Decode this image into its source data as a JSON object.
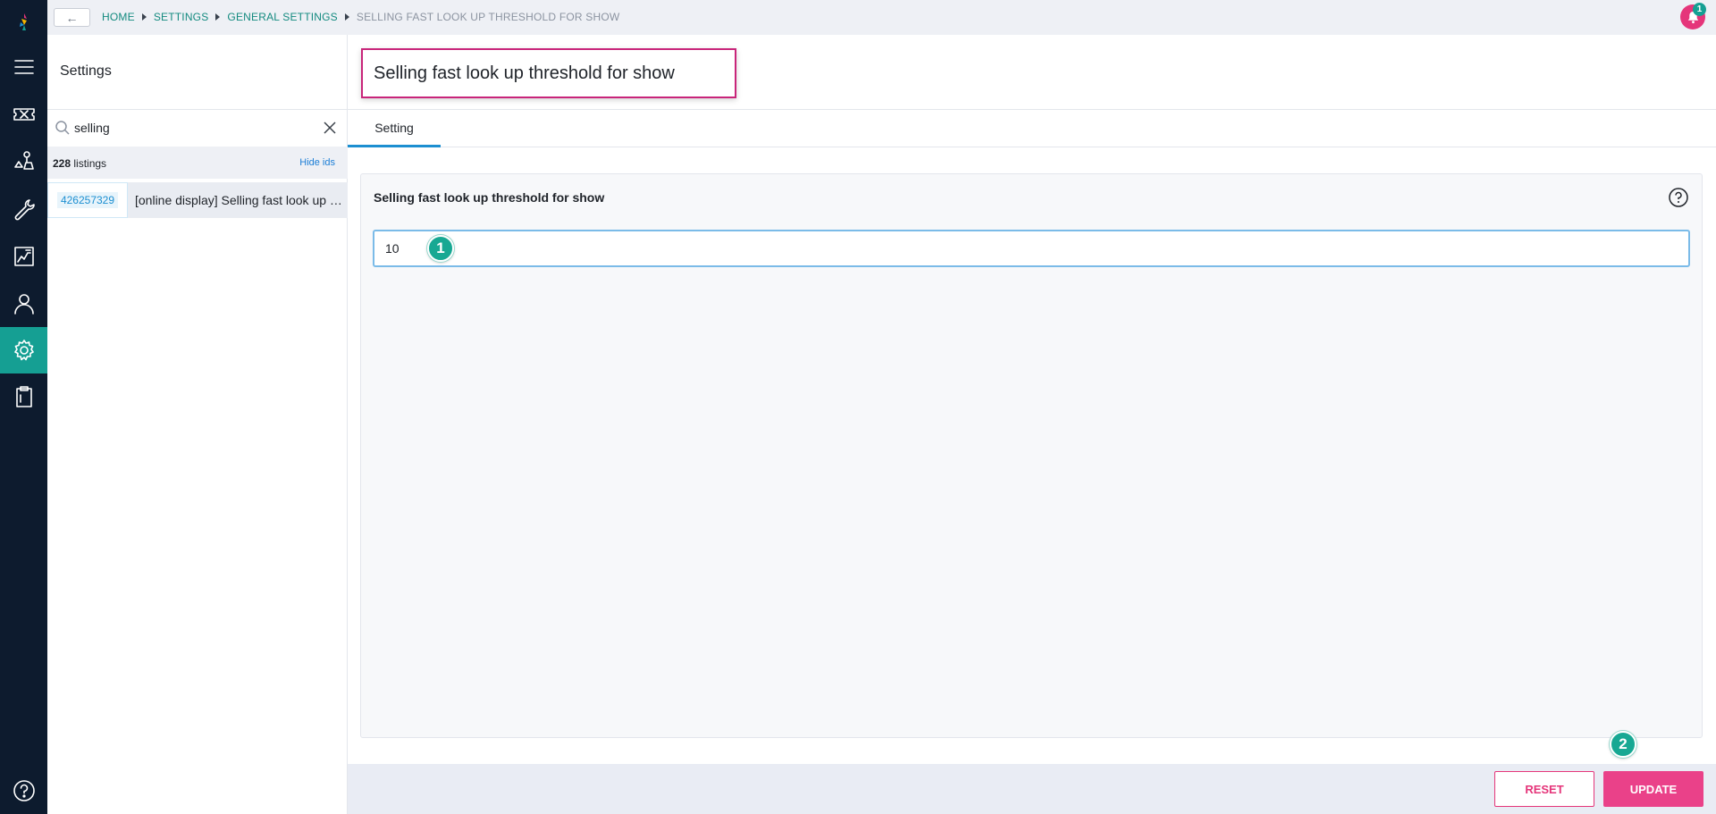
{
  "breadcrumb": {
    "items": [
      "HOME",
      "SETTINGS",
      "GENERAL SETTINGS"
    ],
    "current": "SELLING FAST LOOK UP THRESHOLD FOR SHOW"
  },
  "notifications": {
    "count": "1"
  },
  "settings_panel": {
    "title": "Settings",
    "search_value": "selling",
    "listings_count": "228",
    "listings_label": " listings",
    "hide_ids_label": "Hide ids",
    "results": [
      {
        "id": "426257329",
        "text": "[online display] Selling fast look up threshold for show"
      }
    ]
  },
  "page": {
    "title": "Selling fast look up threshold for show",
    "tabs": [
      {
        "label": "Setting"
      }
    ],
    "setting": {
      "label": "Selling fast look up threshold for show",
      "value": "10"
    },
    "steps": [
      "1",
      "2"
    ],
    "buttons": {
      "reset": "RESET",
      "update": "UPDATE"
    }
  },
  "icons": {
    "rail": [
      "brand-logo-icon",
      "menu-icon",
      "ticket-icon",
      "scale-icon",
      "wrench-icon",
      "report-icon",
      "user-icon",
      "gear-icon",
      "clipboard-icon",
      "help-icon"
    ]
  },
  "colors": {
    "rail_bg": "#0d1b2e",
    "active_teal": "#159f93",
    "accent_pink": "#e5357a",
    "link_teal": "#138a7f",
    "tab_blue": "#1c8fd1"
  }
}
